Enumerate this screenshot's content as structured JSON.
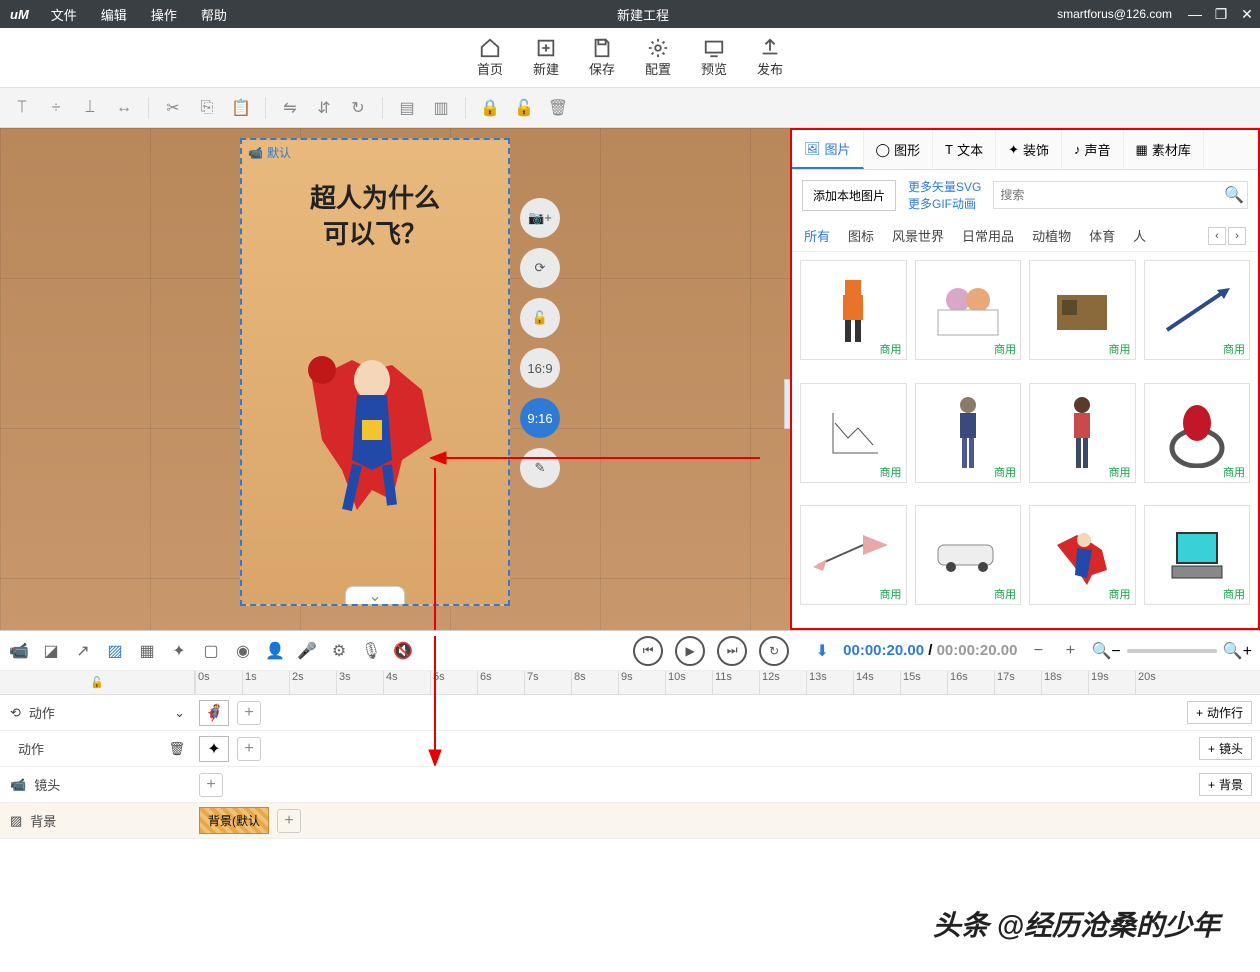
{
  "topbar": {
    "logo": "иM",
    "menus": [
      "文件",
      "编辑",
      "操作",
      "帮助"
    ],
    "title": "新建工程",
    "user": "smartforus@126.com"
  },
  "maintabs": [
    {
      "icon": "home",
      "label": "首页"
    },
    {
      "icon": "new",
      "label": "新建"
    },
    {
      "icon": "save",
      "label": "保存"
    },
    {
      "icon": "config",
      "label": "配置"
    },
    {
      "icon": "preview",
      "label": "预览"
    },
    {
      "icon": "publish",
      "label": "发布"
    }
  ],
  "scene": {
    "tag": "默认",
    "line1": "超人为什么",
    "line2": "可以飞？"
  },
  "sideTools": {
    "ratio1": "16:9",
    "ratio2": "9:16"
  },
  "sidepanel": {
    "tabs": [
      "图片",
      "图形",
      "文本",
      "装饰",
      "声音",
      "素材库"
    ],
    "btnLocal": "添加本地图片",
    "link1": "更多矢量SVG",
    "link2": "更多GIF动画",
    "searchPlaceholder": "搜索",
    "cats": [
      "所有",
      "图标",
      "风景世界",
      "日常用品",
      "动植物",
      "体育",
      "人"
    ],
    "assetTag": "商用"
  },
  "timeline": {
    "current": "00:00:20.00",
    "total": "00:00:20.00",
    "ticks": [
      "0s",
      "1s",
      "2s",
      "3s",
      "4s",
      "5s",
      "6s",
      "7s",
      "8s",
      "9s",
      "10s",
      "11s",
      "12s",
      "13s",
      "14s",
      "15s",
      "16s",
      "17s",
      "18s",
      "19s",
      "20s"
    ],
    "tracks": {
      "action": "动作",
      "action2": "动作",
      "camera": "镜头",
      "bg": "背景",
      "bgClip": "背景(默认",
      "addAction": "动作行",
      "addCamera": "镜头",
      "addBg": "背景"
    }
  },
  "watermark": "头条 @经历沧桑的少年"
}
